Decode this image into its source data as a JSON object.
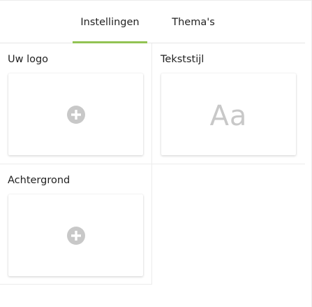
{
  "tabs": [
    {
      "label": "Instellingen",
      "active": true
    },
    {
      "label": "Thema's",
      "active": false
    }
  ],
  "sections": {
    "logo": {
      "label": "Uw logo"
    },
    "text_style": {
      "label": "Tekststijl",
      "preview_text": "Aa"
    },
    "background": {
      "label": "Achtergrond"
    }
  },
  "icons": {
    "add": "plus-circle-icon"
  },
  "colors": {
    "active_tab_underline": "#92c353",
    "icon_gray": "#c8c8c8"
  }
}
